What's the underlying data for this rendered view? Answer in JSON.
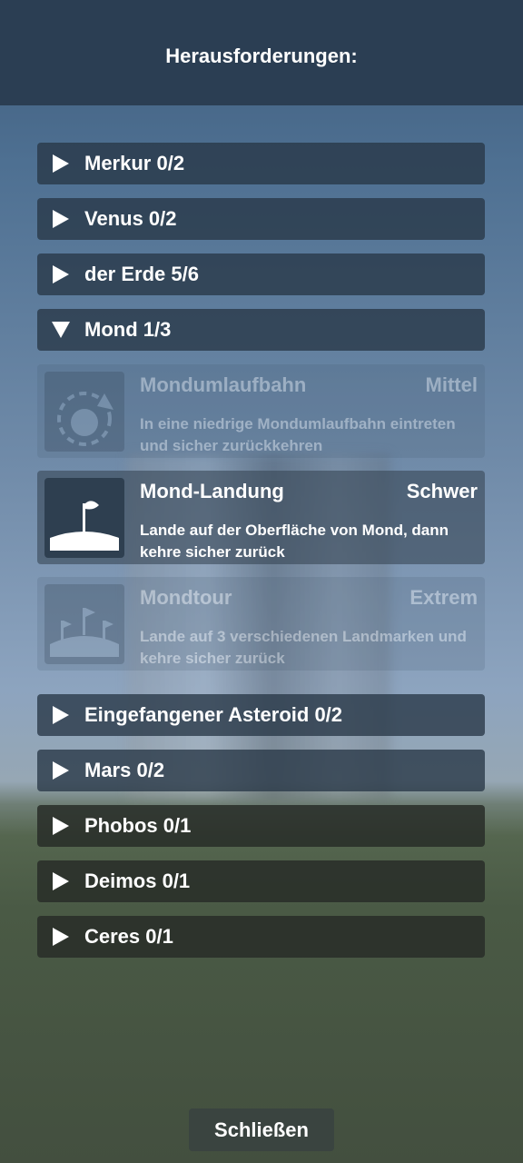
{
  "header": {
    "title": "Herausforderungen:"
  },
  "categories_top": [
    {
      "label": "Merkur 0/2"
    },
    {
      "label": "Venus 0/2"
    },
    {
      "label": "der Erde 5/6"
    },
    {
      "label": "Mond 1/3",
      "expanded": true
    }
  ],
  "challenges": [
    {
      "name": "Mondumlaufbahn",
      "difficulty": "Mittel",
      "description": "In eine niedrige Mondumlaufbahn eintreten und sicher zurückkehren",
      "icon": "lunar-orbit-icon",
      "state": "completed"
    },
    {
      "name": "Mond-Landung",
      "difficulty": "Schwer",
      "description": "Lande auf der Oberfläche von Mond, dann kehre sicher zurück",
      "icon": "flag-landing-icon",
      "state": "active"
    },
    {
      "name": "Mondtour",
      "difficulty": "Extrem",
      "description": "Lande auf 3 verschiedenen Landmarken und kehre sicher zurück",
      "icon": "three-flags-icon",
      "state": "locked"
    }
  ],
  "categories_bottom": [
    {
      "label": "Eingefangener Asteroid 0/2"
    },
    {
      "label": "Mars 0/2"
    },
    {
      "label": "Phobos 0/1"
    },
    {
      "label": "Deimos 0/1"
    },
    {
      "label": "Ceres 0/1"
    }
  ],
  "footer": {
    "close_label": "Schließen"
  }
}
